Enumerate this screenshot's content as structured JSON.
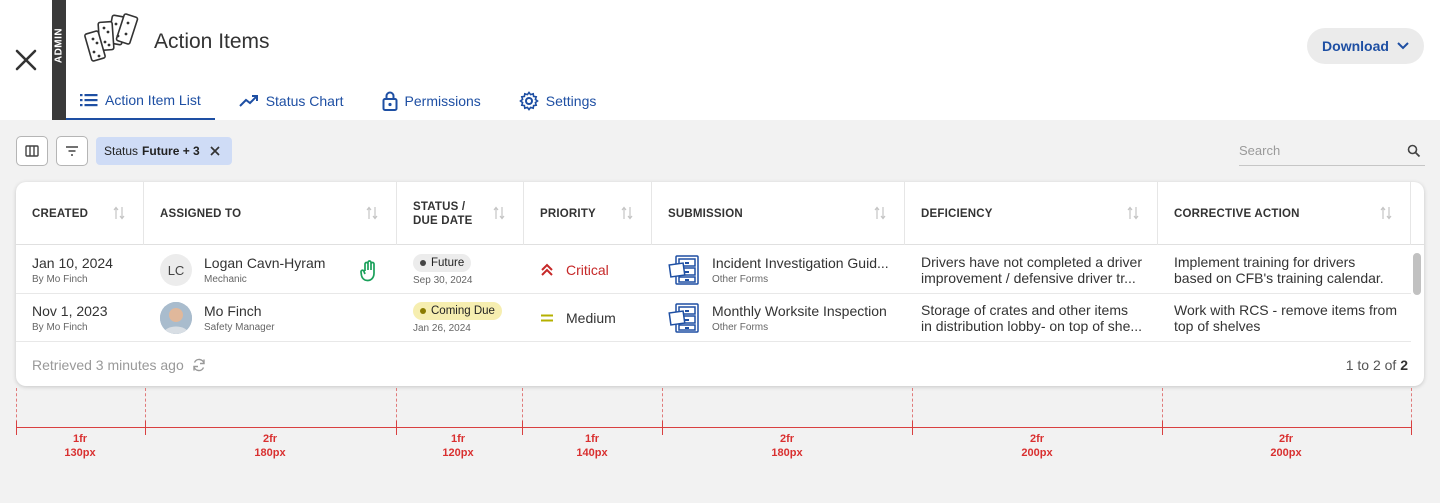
{
  "header": {
    "admin_label": "ADMIN",
    "title": "Action Items",
    "download_label": "Download",
    "tabs": [
      {
        "label": "Action Item List",
        "icon": "list-icon"
      },
      {
        "label": "Status Chart",
        "icon": "trending-up-icon"
      },
      {
        "label": "Permissions",
        "icon": "lock-icon"
      },
      {
        "label": "Settings",
        "icon": "gear-icon"
      }
    ]
  },
  "toolbar": {
    "filter_chip": {
      "key": "Status",
      "value": "Future + 3"
    },
    "search_placeholder": "Search"
  },
  "table": {
    "columns": [
      "CREATED",
      "ASSIGNED TO",
      "STATUS /",
      "DUE DATE",
      "PRIORITY",
      "SUBMISSION",
      "DEFICIENCY",
      "CORRECTIVE ACTION"
    ],
    "rows": [
      {
        "created": "Jan 10, 2024",
        "created_by": "By Mo Finch",
        "assignee_initials": "LC",
        "assignee_name": "Logan Cavn-Hyram",
        "assignee_role": "Mechanic",
        "status": "Future",
        "due_date": "Sep 30, 2024",
        "priority": "Critical",
        "submission_title": "Incident Investigation Guid...",
        "submission_type": "Other Forms",
        "deficiency_1": "Drivers have not completed a driver",
        "deficiency_2": "improvement / defensive driver tr...",
        "action_1": "Implement training for drivers",
        "action_2": "based on CFB's training calendar."
      },
      {
        "created": "Nov 1, 2023",
        "created_by": "By Mo Finch",
        "assignee_name": "Mo Finch",
        "assignee_role": "Safety Manager",
        "status": "Coming Due",
        "due_date": "Jan 26, 2024",
        "priority": "Medium",
        "submission_title": "Monthly Worksite Inspection",
        "submission_type": "Other Forms",
        "deficiency_1": "Storage of crates and other items",
        "deficiency_2": "in distribution lobby- on top of she...",
        "action_1": "Work with RCS - remove items from",
        "action_2": "top of shelves"
      }
    ],
    "retrieved": "Retrieved 3 minutes ago",
    "pagination_prefix": "1 to 2 of",
    "pagination_total": "2"
  },
  "colors": {
    "accent": "#1e4fa3",
    "critical": "#c62828",
    "medium": "#b5b000",
    "future_badge": "#ececec",
    "coming_due_badge": "#f6eeb0",
    "annotation": "#d93030"
  },
  "annotations": [
    {
      "fr": "1fr",
      "px": "130px"
    },
    {
      "fr": "2fr",
      "px": "180px"
    },
    {
      "fr": "1fr",
      "px": "120px"
    },
    {
      "fr": "1fr",
      "px": "140px"
    },
    {
      "fr": "2fr",
      "px": "180px"
    },
    {
      "fr": "2fr",
      "px": "200px"
    },
    {
      "fr": "2fr",
      "px": "200px"
    }
  ]
}
